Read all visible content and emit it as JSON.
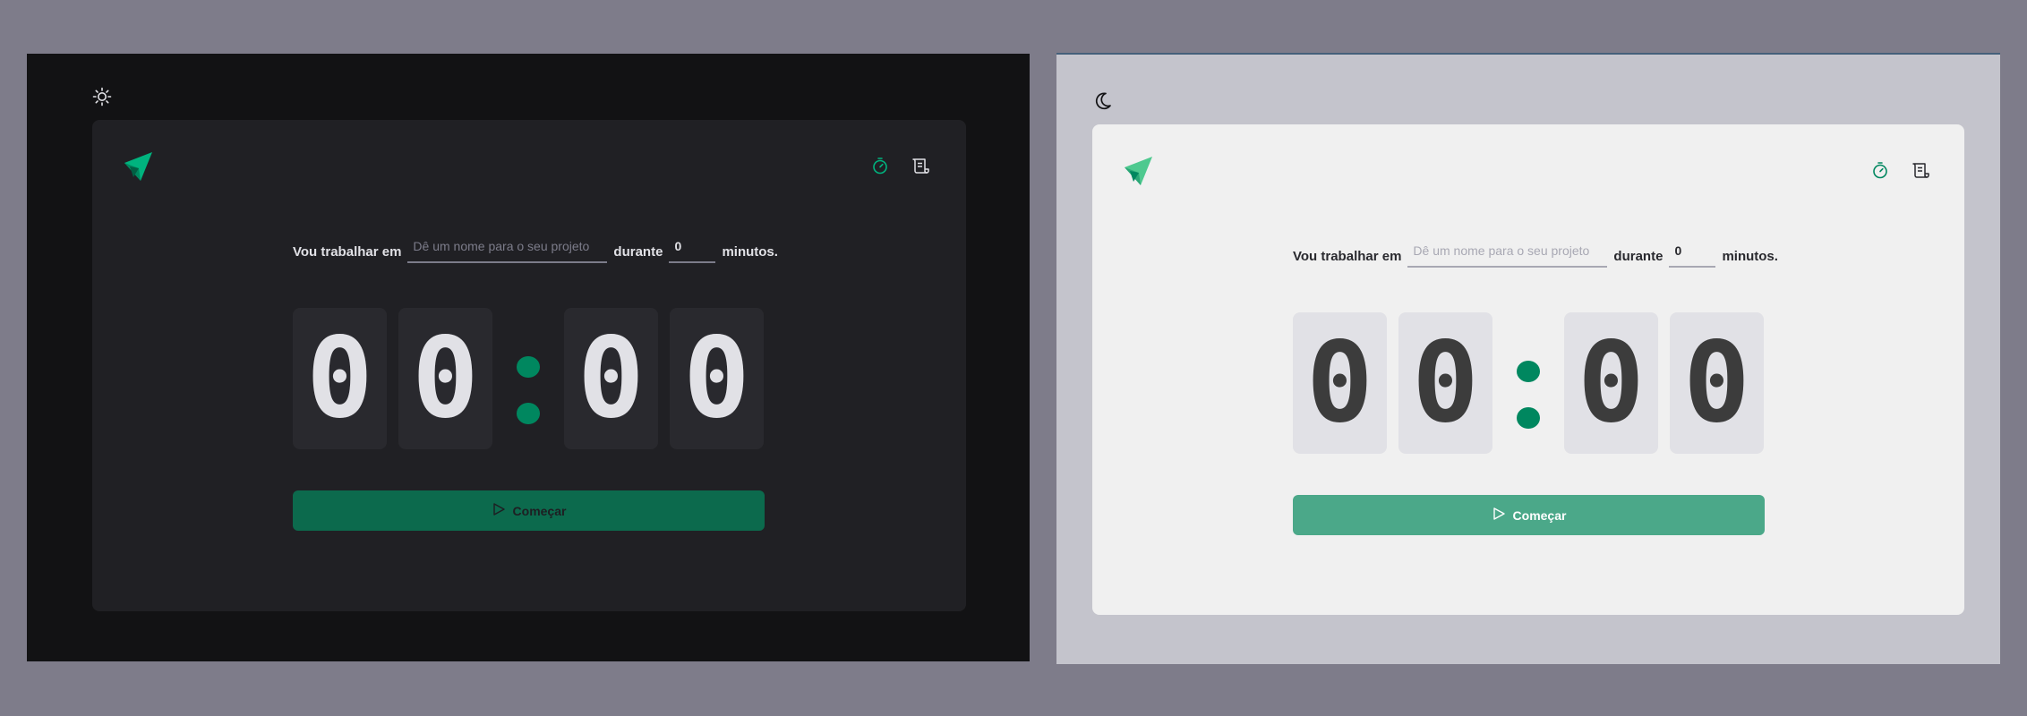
{
  "colors": {
    "accent": "#00875f",
    "dark_bg": "#121214",
    "light_bg": "#c4c4cc"
  },
  "dark": {
    "theme_icon": "sun-icon",
    "form": {
      "label": "Vou trabalhar em",
      "project_placeholder": "Dê um nome para o seu projeto",
      "during": "durante",
      "minutes_value": "0",
      "minutes_suffix": "minutos."
    },
    "countdown": {
      "digits": [
        "0",
        "0",
        "0",
        "0"
      ],
      "separator": ":"
    },
    "start_label": "Começar"
  },
  "light": {
    "theme_icon": "moon-icon",
    "form": {
      "label": "Vou trabalhar em",
      "project_placeholder": "Dê um nome para o seu projeto",
      "during": "durante",
      "minutes_value": "0",
      "minutes_suffix": "minutos."
    },
    "countdown": {
      "digits": [
        "0",
        "0",
        "0",
        "0"
      ],
      "separator": ":"
    },
    "start_label": "Começar"
  },
  "nav": {
    "timer_icon": "timer-icon",
    "history_icon": "scroll-icon"
  }
}
